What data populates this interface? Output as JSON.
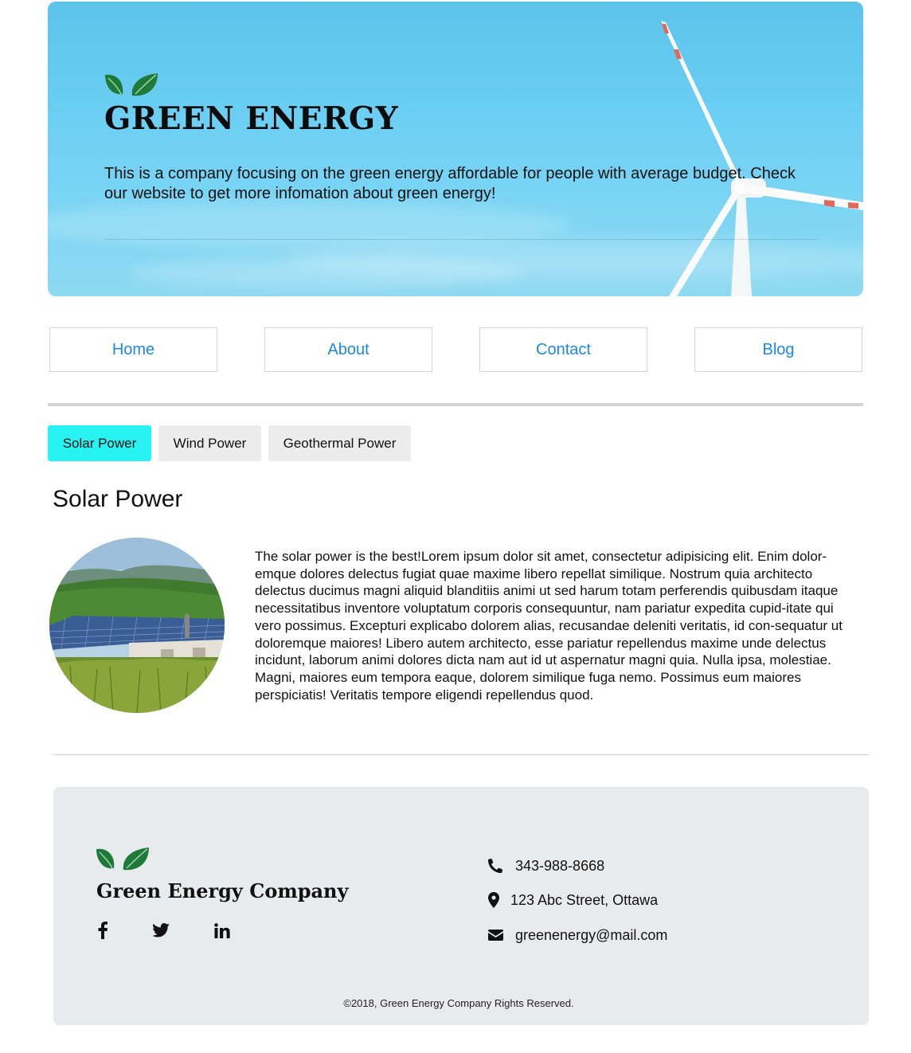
{
  "hero": {
    "title": "GREEN ENERGY",
    "description": "This is a company focusing on the green energy affordable for people with average budget. Check our website to get more infomation about green energy!",
    "logo_icon": "leaves-icon"
  },
  "nav": {
    "items": [
      {
        "label": "Home"
      },
      {
        "label": "About"
      },
      {
        "label": "Contact"
      },
      {
        "label": "Blog"
      }
    ]
  },
  "tabs": {
    "items": [
      {
        "label": "Solar Power",
        "active": true
      },
      {
        "label": "Wind Power",
        "active": false
      },
      {
        "label": "Geothermal Power",
        "active": false
      }
    ]
  },
  "content": {
    "title": "Solar Power",
    "body": "The solar power is the best!Lorem ipsum dolor sit amet, consectetur adipisicing elit. Enim dolor-emque dolores delectus fugiat quae maxime libero repellat similique. Nostrum quia architecto delectus ducimus magni aliquid blanditiis animi ut sed harum totam perferendis quibusdam itaque necessitatibus inventore voluptatum corporis consequuntur, nam pariatur expedita cupid-itate qui vero possimus. Excepturi explicabo dolorem alias, recusandae deleniti veritatis, id con-sequatur ut doloremque maiores! Libero autem architecto, esse pariatur repellendus maxime unde delectus incidunt, laborum animi dolores dicta nam aut id ut aspernatur magni quia. Nulla ipsa, molestiae. Magni, maiores eum tempora eaque, dolorem similique fuga nemo. Possimus eum maiores perspiciatis! Veritatis tempore eligendi repellendus quod."
  },
  "footer": {
    "company": "Green Energy Company",
    "social": [
      "facebook-icon",
      "twitter-icon",
      "linkedin-icon"
    ],
    "contacts": {
      "phone": "343-988-8668",
      "address": "123 Abc Street, Ottawa",
      "email": "greenenergy@mail.com"
    },
    "copyright": "©2018, Green Energy Company Rights Reserved."
  },
  "colors": {
    "accent_link": "#1e88e5",
    "tab_active": "#27f3f3",
    "leaf_green": "#1f7a3a",
    "footer_bg": "#e8ebee"
  }
}
